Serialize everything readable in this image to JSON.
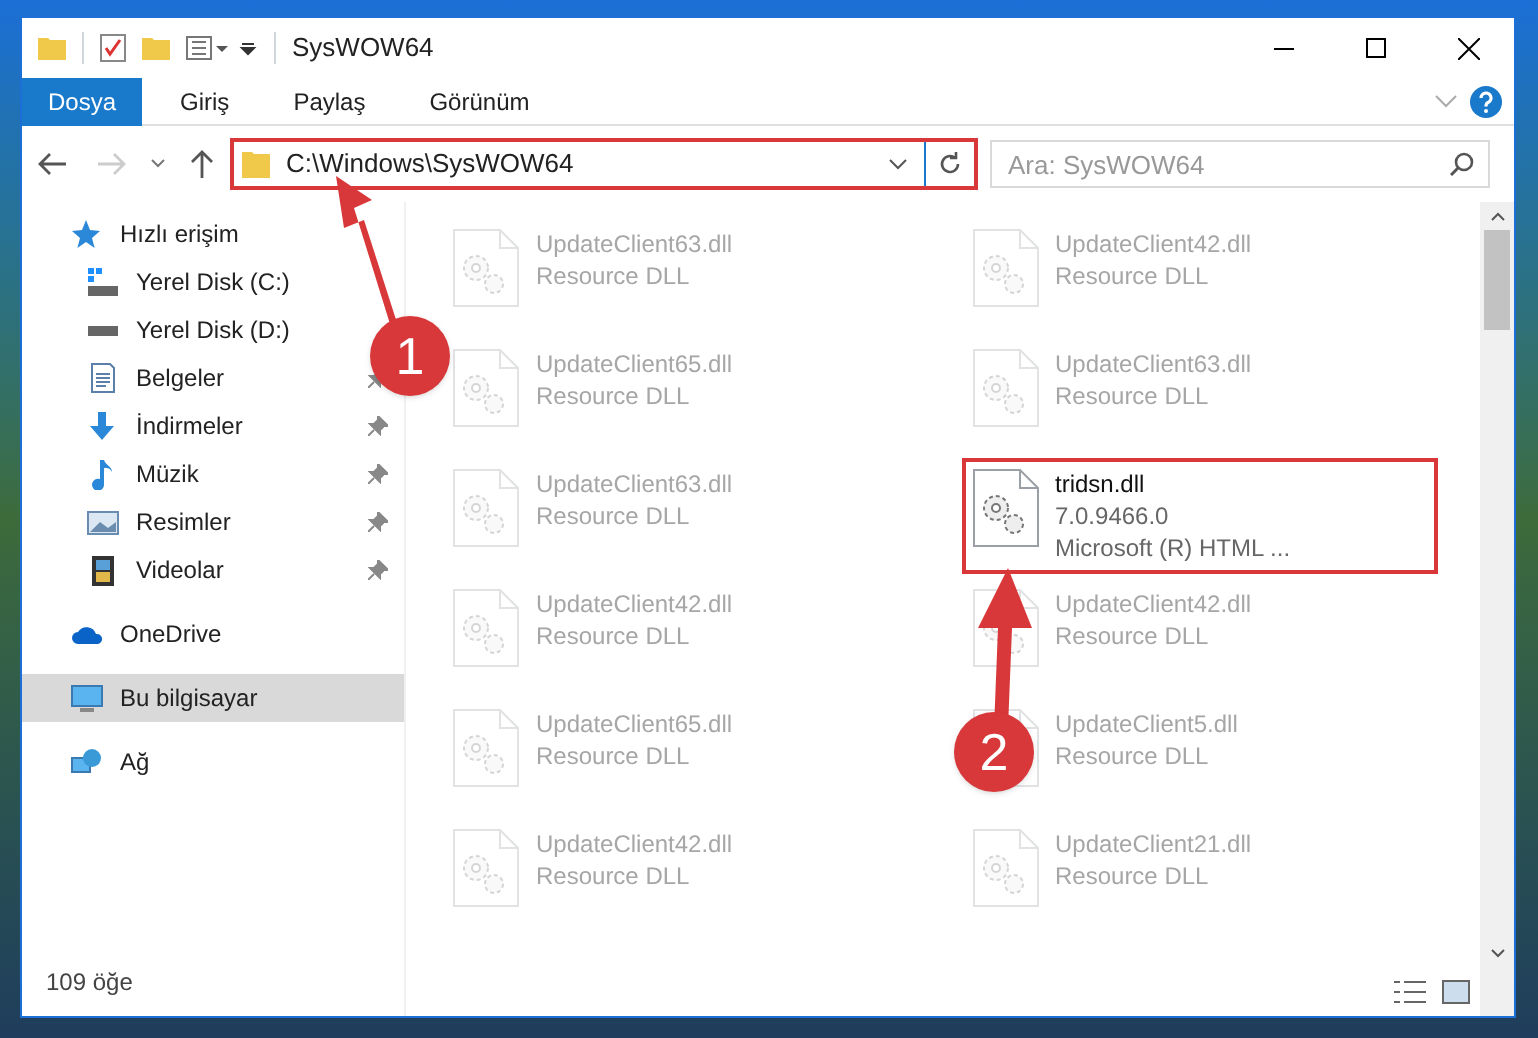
{
  "window": {
    "title": "SysWOW64"
  },
  "ribbon_tabs": [
    {
      "label": "Dosya",
      "selected": true
    },
    {
      "label": "Giriş",
      "selected": false
    },
    {
      "label": "Paylaş",
      "selected": false
    },
    {
      "label": "Görünüm",
      "selected": false
    }
  ],
  "address": {
    "path": "C:\\Windows\\SysWOW64",
    "highlighted": true
  },
  "search": {
    "placeholder": "Ara: SysWOW64"
  },
  "sidebar": {
    "items": [
      {
        "label": "Hızlı erişim",
        "kind": "star",
        "selected": false,
        "children": [
          {
            "label": "Yerel Disk (C:)",
            "kind": "disk-c",
            "pinned": false
          },
          {
            "label": "Yerel Disk (D:)",
            "kind": "disk",
            "pinned": false
          },
          {
            "label": "Belgeler",
            "kind": "docs",
            "pinned": true
          },
          {
            "label": "İndirmeler",
            "kind": "download",
            "pinned": true
          },
          {
            "label": "Müzik",
            "kind": "music",
            "pinned": true
          },
          {
            "label": "Resimler",
            "kind": "pictures",
            "pinned": true
          },
          {
            "label": "Videolar",
            "kind": "video",
            "pinned": true
          }
        ]
      },
      {
        "label": "OneDrive",
        "kind": "cloud",
        "selected": false
      },
      {
        "label": "Bu bilgisayar",
        "kind": "pc",
        "selected": true
      },
      {
        "label": "Ağ",
        "kind": "network",
        "selected": false
      }
    ]
  },
  "files": [
    {
      "name": "UpdateClient63.dll",
      "type": "Resource DLL",
      "highlighted": false
    },
    {
      "name": "UpdateClient42.dll",
      "type": "Resource DLL",
      "highlighted": false
    },
    {
      "name": "UpdateClient65.dll",
      "type": "Resource DLL",
      "highlighted": false
    },
    {
      "name": "UpdateClient63.dll",
      "type": "Resource DLL",
      "highlighted": false
    },
    {
      "name": "UpdateClient63.dll",
      "type": "Resource DLL",
      "highlighted": false
    },
    {
      "name": "tridsn.dll",
      "version": "7.0.9466.0",
      "type": "Microsoft (R) HTML ...",
      "highlighted": true
    },
    {
      "name": "UpdateClient42.dll",
      "type": "Resource DLL",
      "highlighted": false
    },
    {
      "name": "UpdateClient42.dll",
      "type": "Resource DLL",
      "highlighted": false
    },
    {
      "name": "UpdateClient65.dll",
      "type": "Resource DLL",
      "highlighted": false
    },
    {
      "name": "UpdateClient5.dll",
      "type": "Resource DLL",
      "highlighted": false
    },
    {
      "name": "UpdateClient42.dll",
      "type": "Resource DLL",
      "highlighted": false
    },
    {
      "name": "UpdateClient21.dll",
      "type": "Resource DLL",
      "highlighted": false
    }
  ],
  "status_bar": {
    "item_count": "109 öğe"
  },
  "callouts": [
    "1",
    "2"
  ]
}
